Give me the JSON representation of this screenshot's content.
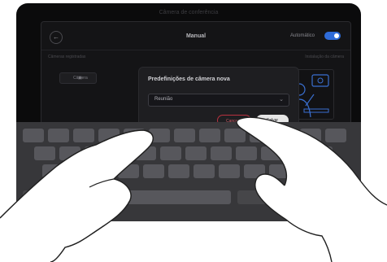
{
  "top_caption": "Câmera de conferência",
  "screen": {
    "back_icon": "arrow-left-icon",
    "title": "Manual",
    "auto_label": "Automático",
    "toggle_on": true,
    "left_hint": "Câmeras registradas",
    "right_hint": "Instalação da câmera",
    "camera_chip": "Câmera",
    "camera_icon": "camera-icon"
  },
  "dialog": {
    "title": "Predefinições de câmera nova",
    "dropdown_value": "Reunião",
    "dropdown_icon": "chevron-down-icon",
    "cancel_label": "Cancelar",
    "save_label": "Salvar",
    "cancel_color": "#b8313f"
  },
  "keyboard": {
    "rows": [
      [
        "",
        "",
        "",
        "",
        "",
        "",
        "",
        "",
        "",
        "",
        "",
        "",
        ""
      ],
      [
        "",
        "",
        "",
        "",
        "",
        "",
        "",
        "",
        "",
        "",
        "",
        ""
      ],
      [
        "",
        "",
        "",
        "",
        "",
        "",
        "",
        "",
        "",
        "",
        ""
      ],
      [
        "",
        "",
        "",
        "",
        ""
      ]
    ]
  }
}
